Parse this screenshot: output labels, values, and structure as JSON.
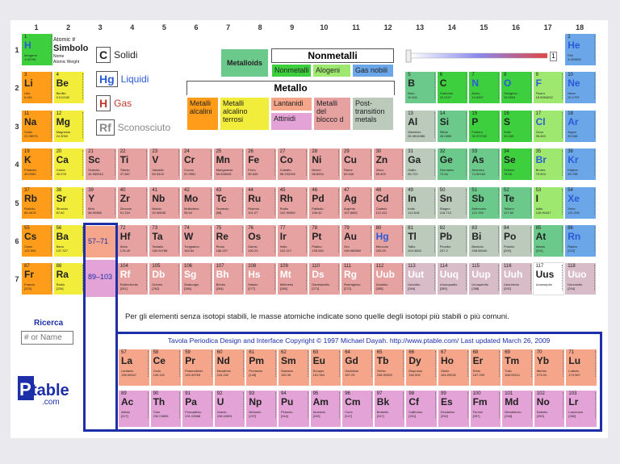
{
  "groups": [
    "1",
    "2",
    "3",
    "4",
    "5",
    "6",
    "7",
    "8",
    "9",
    "10",
    "11",
    "12",
    "13",
    "14",
    "15",
    "16",
    "17",
    "18"
  ],
  "periods": [
    "1",
    "2",
    "3",
    "4",
    "5",
    "6",
    "7"
  ],
  "legend": {
    "atomic_no_label": "Atomic #",
    "symbol_label": "Simbolo",
    "name_label": "Nome",
    "mass_label": "Atomic Weight",
    "states": [
      {
        "code": "C",
        "label": "Solidi",
        "color": "#222222"
      },
      {
        "code": "Hg",
        "label": "Liquidi",
        "color": "#2a5bd7"
      },
      {
        "code": "H",
        "label": "Gas",
        "color": "#c0392b"
      },
      {
        "code": "Rf",
        "label": "Sconosciuto",
        "color": "#888888"
      }
    ],
    "metalloids": "Metalloids",
    "nonmetals_header": "Nonmetalli",
    "nonmetals": [
      {
        "label": "Nonmetalli",
        "color": "#3ecf3e"
      },
      {
        "label": "Alogeni",
        "color": "#9fe86f"
      },
      {
        "label": "Gas nobili",
        "color": "#6aa6e8"
      }
    ],
    "metals_header": "Metallo",
    "metals": [
      {
        "label": "Metalli alcalini",
        "color": "#ff9d1a"
      },
      {
        "label": "Metalli alcalino terrosi",
        "color": "#f2ec3a"
      },
      {
        "label": "Lantanidi",
        "color": "#f4a58a"
      },
      {
        "label": "Attinidi",
        "color": "#e4a3d6"
      },
      {
        "label": "Metalli del blocco d",
        "color": "#e6a1a1"
      },
      {
        "label": "Post-transition metals",
        "color": "#bccabc"
      }
    ],
    "slider_value": "1"
  },
  "colors": {
    "alkali": "#ff9d1a",
    "alkaline": "#f2ec3a",
    "transition": "#e6a1a1",
    "post": "#bccabc",
    "metalloid": "#6cc98c",
    "nonmetal": "#3ecf3e",
    "halogen": "#9fe86f",
    "noble": "#6aa6e8",
    "lanthanide": "#f4a58a",
    "actinide": "#e4a3d6",
    "unknown": "#d8bcc8",
    "hydrogen": "#3ecf3e"
  },
  "elements": [
    {
      "n": "1",
      "s": "H",
      "nm": "Idrogeno",
      "m": "1.00794",
      "g": 1,
      "p": 1,
      "c": "hydrogen",
      "st": "gas"
    },
    {
      "n": "2",
      "s": "He",
      "nm": "Elio",
      "m": "4.002602",
      "g": 18,
      "p": 1,
      "c": "noble",
      "st": "gas"
    },
    {
      "n": "3",
      "s": "Li",
      "nm": "Litio",
      "m": "6.941",
      "g": 1,
      "p": 2,
      "c": "alkali"
    },
    {
      "n": "4",
      "s": "Be",
      "nm": "Berillio",
      "m": "9.012182",
      "g": 2,
      "p": 2,
      "c": "alkaline"
    },
    {
      "n": "5",
      "s": "B",
      "nm": "Boro",
      "m": "10.811",
      "g": 13,
      "p": 2,
      "c": "metalloid"
    },
    {
      "n": "6",
      "s": "C",
      "nm": "Carbonio",
      "m": "12.0107",
      "g": 14,
      "p": 2,
      "c": "nonmetal"
    },
    {
      "n": "7",
      "s": "N",
      "nm": "Azoto",
      "m": "14.0067",
      "g": 15,
      "p": 2,
      "c": "nonmetal",
      "st": "gas"
    },
    {
      "n": "8",
      "s": "O",
      "nm": "Ossigeno",
      "m": "15.9994",
      "g": 16,
      "p": 2,
      "c": "nonmetal",
      "st": "gas"
    },
    {
      "n": "9",
      "s": "F",
      "nm": "Fluoro",
      "m": "18.9984032",
      "g": 17,
      "p": 2,
      "c": "halogen",
      "st": "gas"
    },
    {
      "n": "10",
      "s": "Ne",
      "nm": "Neon",
      "m": "20.1797",
      "g": 18,
      "p": 2,
      "c": "noble",
      "st": "gas"
    },
    {
      "n": "11",
      "s": "Na",
      "nm": "Sodio",
      "m": "22.98976",
      "g": 1,
      "p": 3,
      "c": "alkali"
    },
    {
      "n": "12",
      "s": "Mg",
      "nm": "Magnesio",
      "m": "24.3050",
      "g": 2,
      "p": 3,
      "c": "alkaline"
    },
    {
      "n": "13",
      "s": "Al",
      "nm": "Alluminio",
      "m": "26.9815386",
      "g": 13,
      "p": 3,
      "c": "post"
    },
    {
      "n": "14",
      "s": "Si",
      "nm": "Silicio",
      "m": "28.0855",
      "g": 14,
      "p": 3,
      "c": "metalloid"
    },
    {
      "n": "15",
      "s": "P",
      "nm": "Fosforo",
      "m": "30.973762",
      "g": 15,
      "p": 3,
      "c": "nonmetal"
    },
    {
      "n": "16",
      "s": "S",
      "nm": "Zolfo",
      "m": "32.065",
      "g": 16,
      "p": 3,
      "c": "nonmetal"
    },
    {
      "n": "17",
      "s": "Cl",
      "nm": "Cloro",
      "m": "35.453",
      "g": 17,
      "p": 3,
      "c": "halogen",
      "st": "gas"
    },
    {
      "n": "18",
      "s": "Ar",
      "nm": "Argon",
      "m": "39.948",
      "g": 18,
      "p": 3,
      "c": "noble",
      "st": "gas"
    },
    {
      "n": "19",
      "s": "K",
      "nm": "Potassio",
      "m": "39.0983",
      "g": 1,
      "p": 4,
      "c": "alkali"
    },
    {
      "n": "20",
      "s": "Ca",
      "nm": "Calcio",
      "m": "40.078",
      "g": 2,
      "p": 4,
      "c": "alkaline"
    },
    {
      "n": "21",
      "s": "Sc",
      "nm": "Scandio",
      "m": "44.955912",
      "g": 3,
      "p": 4,
      "c": "transition"
    },
    {
      "n": "22",
      "s": "Ti",
      "nm": "Titanio",
      "m": "47.867",
      "g": 4,
      "p": 4,
      "c": "transition"
    },
    {
      "n": "23",
      "s": "V",
      "nm": "Vanadio",
      "m": "50.9415",
      "g": 5,
      "p": 4,
      "c": "transition"
    },
    {
      "n": "24",
      "s": "Cr",
      "nm": "Cromo",
      "m": "51.9961",
      "g": 6,
      "p": 4,
      "c": "transition"
    },
    {
      "n": "25",
      "s": "Mn",
      "nm": "Manganese",
      "m": "54.938045",
      "g": 7,
      "p": 4,
      "c": "transition"
    },
    {
      "n": "26",
      "s": "Fe",
      "nm": "Ferro",
      "m": "55.845",
      "g": 8,
      "p": 4,
      "c": "transition"
    },
    {
      "n": "27",
      "s": "Co",
      "nm": "Cobalto",
      "m": "58.933195",
      "g": 9,
      "p": 4,
      "c": "transition"
    },
    {
      "n": "28",
      "s": "Ni",
      "nm": "Nichel",
      "m": "58.6934",
      "g": 10,
      "p": 4,
      "c": "transition"
    },
    {
      "n": "29",
      "s": "Cu",
      "nm": "Rame",
      "m": "63.546",
      "g": 11,
      "p": 4,
      "c": "transition"
    },
    {
      "n": "30",
      "s": "Zn",
      "nm": "Zinco",
      "m": "65.409",
      "g": 12,
      "p": 4,
      "c": "transition"
    },
    {
      "n": "31",
      "s": "Ga",
      "nm": "Gallio",
      "m": "69.723",
      "g": 13,
      "p": 4,
      "c": "post"
    },
    {
      "n": "32",
      "s": "Ge",
      "nm": "Germanio",
      "m": "72.64",
      "g": 14,
      "p": 4,
      "c": "metalloid"
    },
    {
      "n": "33",
      "s": "As",
      "nm": "Arsenico",
      "m": "74.92160",
      "g": 15,
      "p": 4,
      "c": "metalloid"
    },
    {
      "n": "34",
      "s": "Se",
      "nm": "Selenio",
      "m": "78.96",
      "g": 16,
      "p": 4,
      "c": "nonmetal"
    },
    {
      "n": "35",
      "s": "Br",
      "nm": "Bromo",
      "m": "79.904",
      "g": 17,
      "p": 4,
      "c": "halogen",
      "st": "liq"
    },
    {
      "n": "36",
      "s": "Kr",
      "nm": "Kripton",
      "m": "83.798",
      "g": 18,
      "p": 4,
      "c": "noble",
      "st": "gas"
    },
    {
      "n": "37",
      "s": "Rb",
      "nm": "Rubidio",
      "m": "85.4678",
      "g": 1,
      "p": 5,
      "c": "alkali"
    },
    {
      "n": "38",
      "s": "Sr",
      "nm": "Stronzio",
      "m": "87.62",
      "g": 2,
      "p": 5,
      "c": "alkaline"
    },
    {
      "n": "39",
      "s": "Y",
      "nm": "Ittrio",
      "m": "88.90585",
      "g": 3,
      "p": 5,
      "c": "transition"
    },
    {
      "n": "40",
      "s": "Zr",
      "nm": "Zirconio",
      "m": "91.224",
      "g": 4,
      "p": 5,
      "c": "transition"
    },
    {
      "n": "41",
      "s": "Nb",
      "nm": "Niobio",
      "m": "92.90638",
      "g": 5,
      "p": 5,
      "c": "transition"
    },
    {
      "n": "42",
      "s": "Mo",
      "nm": "Molibdeno",
      "m": "95.94",
      "g": 6,
      "p": 5,
      "c": "transition"
    },
    {
      "n": "43",
      "s": "Tc",
      "nm": "Tecnezio",
      "m": "[98]",
      "g": 7,
      "p": 5,
      "c": "transition"
    },
    {
      "n": "44",
      "s": "Ru",
      "nm": "Rutenio",
      "m": "101.07",
      "g": 8,
      "p": 5,
      "c": "transition"
    },
    {
      "n": "45",
      "s": "Rh",
      "nm": "Rodio",
      "m": "102.90550",
      "g": 9,
      "p": 5,
      "c": "transition"
    },
    {
      "n": "46",
      "s": "Pd",
      "nm": "Palladio",
      "m": "106.42",
      "g": 10,
      "p": 5,
      "c": "transition"
    },
    {
      "n": "47",
      "s": "Ag",
      "nm": "Argento",
      "m": "107.8682",
      "g": 11,
      "p": 5,
      "c": "transition"
    },
    {
      "n": "48",
      "s": "Cd",
      "nm": "Cadmio",
      "m": "112.411",
      "g": 12,
      "p": 5,
      "c": "transition"
    },
    {
      "n": "49",
      "s": "In",
      "nm": "Indio",
      "m": "114.818",
      "g": 13,
      "p": 5,
      "c": "post"
    },
    {
      "n": "50",
      "s": "Sn",
      "nm": "Stagno",
      "m": "118.710",
      "g": 14,
      "p": 5,
      "c": "post"
    },
    {
      "n": "51",
      "s": "Sb",
      "nm": "Antimonio",
      "m": "121.760",
      "g": 15,
      "p": 5,
      "c": "metalloid"
    },
    {
      "n": "52",
      "s": "Te",
      "nm": "Tellurio",
      "m": "127.60",
      "g": 16,
      "p": 5,
      "c": "metalloid"
    },
    {
      "n": "53",
      "s": "I",
      "nm": "Iodio",
      "m": "126.90447",
      "g": 17,
      "p": 5,
      "c": "halogen"
    },
    {
      "n": "54",
      "s": "Xe",
      "nm": "Xeno",
      "m": "131.293",
      "g": 18,
      "p": 5,
      "c": "noble",
      "st": "gas"
    },
    {
      "n": "55",
      "s": "Cs",
      "nm": "Cesio",
      "m": "132.905",
      "g": 1,
      "p": 6,
      "c": "alkali"
    },
    {
      "n": "56",
      "s": "Ba",
      "nm": "Bario",
      "m": "137.327",
      "g": 2,
      "p": 6,
      "c": "alkaline"
    },
    {
      "n": "72",
      "s": "Hf",
      "nm": "Afnio",
      "m": "178.49",
      "g": 4,
      "p": 6,
      "c": "transition"
    },
    {
      "n": "73",
      "s": "Ta",
      "nm": "Tantalio",
      "m": "180.94788",
      "g": 5,
      "p": 6,
      "c": "transition"
    },
    {
      "n": "74",
      "s": "W",
      "nm": "Tungsteno",
      "m": "183.84",
      "g": 6,
      "p": 6,
      "c": "transition"
    },
    {
      "n": "75",
      "s": "Re",
      "nm": "Renio",
      "m": "186.207",
      "g": 7,
      "p": 6,
      "c": "transition"
    },
    {
      "n": "76",
      "s": "Os",
      "nm": "Osmio",
      "m": "190.23",
      "g": 8,
      "p": 6,
      "c": "transition"
    },
    {
      "n": "77",
      "s": "Ir",
      "nm": "Iridio",
      "m": "192.217",
      "g": 9,
      "p": 6,
      "c": "transition"
    },
    {
      "n": "78",
      "s": "Pt",
      "nm": "Platino",
      "m": "195.084",
      "g": 10,
      "p": 6,
      "c": "transition"
    },
    {
      "n": "79",
      "s": "Au",
      "nm": "Oro",
      "m": "196.966569",
      "g": 11,
      "p": 6,
      "c": "transition"
    },
    {
      "n": "80",
      "s": "Hg",
      "nm": "Mercurio",
      "m": "200.59",
      "g": 12,
      "p": 6,
      "c": "transition",
      "st": "liq"
    },
    {
      "n": "81",
      "s": "Tl",
      "nm": "Tallio",
      "m": "204.3833",
      "g": 13,
      "p": 6,
      "c": "post"
    },
    {
      "n": "82",
      "s": "Pb",
      "nm": "Piombo",
      "m": "207.2",
      "g": 14,
      "p": 6,
      "c": "post"
    },
    {
      "n": "83",
      "s": "Bi",
      "nm": "Bismuto",
      "m": "208.98040",
      "g": 15,
      "p": 6,
      "c": "post"
    },
    {
      "n": "84",
      "s": "Po",
      "nm": "Polonio",
      "m": "[209]",
      "g": 16,
      "p": 6,
      "c": "post"
    },
    {
      "n": "85",
      "s": "At",
      "nm": "Astato",
      "m": "[210]",
      "g": 17,
      "p": 6,
      "c": "metalloid"
    },
    {
      "n": "86",
      "s": "Rn",
      "nm": "Radon",
      "m": "[222]",
      "g": 18,
      "p": 6,
      "c": "noble",
      "st": "gas"
    },
    {
      "n": "87",
      "s": "Fr",
      "nm": "Francio",
      "m": "[223]",
      "g": 1,
      "p": 7,
      "c": "alkali"
    },
    {
      "n": "88",
      "s": "Ra",
      "nm": "Radio",
      "m": "[226]",
      "g": 2,
      "p": 7,
      "c": "alkaline"
    },
    {
      "n": "104",
      "s": "Rf",
      "nm": "Rutherfordio",
      "m": "[261]",
      "g": 4,
      "p": 7,
      "c": "transition",
      "st": "unk"
    },
    {
      "n": "105",
      "s": "Db",
      "nm": "Dubnio",
      "m": "[262]",
      "g": 5,
      "p": 7,
      "c": "transition",
      "st": "unk"
    },
    {
      "n": "106",
      "s": "Sg",
      "nm": "Seaborgio",
      "m": "[266]",
      "g": 6,
      "p": 7,
      "c": "transition",
      "st": "unk"
    },
    {
      "n": "107",
      "s": "Bh",
      "nm": "Bohrio",
      "m": "[264]",
      "g": 7,
      "p": 7,
      "c": "transition",
      "st": "unk"
    },
    {
      "n": "108",
      "s": "Hs",
      "nm": "Hassio",
      "m": "[277]",
      "g": 8,
      "p": 7,
      "c": "transition",
      "st": "unk"
    },
    {
      "n": "109",
      "s": "Mt",
      "nm": "Meitnerio",
      "m": "[268]",
      "g": 9,
      "p": 7,
      "c": "transition",
      "st": "unk"
    },
    {
      "n": "110",
      "s": "Ds",
      "nm": "Darmstadtio",
      "m": "[271]",
      "g": 10,
      "p": 7,
      "c": "transition",
      "st": "unk"
    },
    {
      "n": "111",
      "s": "Rg",
      "nm": "Roentgenio",
      "m": "[272]",
      "g": 11,
      "p": 7,
      "c": "transition",
      "st": "unk"
    },
    {
      "n": "112",
      "s": "Uub",
      "nm": "Ununbio",
      "m": "[285]",
      "g": 12,
      "p": 7,
      "c": "transition",
      "st": "unk"
    },
    {
      "n": "113",
      "s": "Uut",
      "nm": "Ununtrio",
      "m": "[284]",
      "g": 13,
      "p": 7,
      "c": "unknown",
      "st": "unk"
    },
    {
      "n": "114",
      "s": "Uuq",
      "nm": "Ununquadio",
      "m": "[289]",
      "g": 14,
      "p": 7,
      "c": "unknown",
      "st": "unk"
    },
    {
      "n": "115",
      "s": "Uup",
      "nm": "Ununpentio",
      "m": "[288]",
      "g": 15,
      "p": 7,
      "c": "unknown",
      "st": "unk"
    },
    {
      "n": "116",
      "s": "Uuh",
      "nm": "Ununhexio",
      "m": "[292]",
      "g": 16,
      "p": 7,
      "c": "unknown",
      "st": "unk"
    },
    {
      "n": "117",
      "s": "Uus",
      "nm": "Ununseptio",
      "m": "",
      "g": 17,
      "p": 7,
      "c": "empty"
    },
    {
      "n": "118",
      "s": "Uuo",
      "nm": "Ununoctio",
      "m": "[294]",
      "g": 18,
      "p": 7,
      "c": "unknown",
      "st": "unk"
    }
  ],
  "lanthanides": [
    {
      "n": "57",
      "s": "La",
      "nm": "Lantanio",
      "m": "138.90547"
    },
    {
      "n": "58",
      "s": "Ce",
      "nm": "Cerio",
      "m": "140.116"
    },
    {
      "n": "59",
      "s": "Pr",
      "nm": "Praseodimio",
      "m": "140.90765"
    },
    {
      "n": "60",
      "s": "Nd",
      "nm": "Neodimio",
      "m": "144.242"
    },
    {
      "n": "61",
      "s": "Pm",
      "nm": "Promezio",
      "m": "[145]"
    },
    {
      "n": "62",
      "s": "Sm",
      "nm": "Samario",
      "m": "150.36"
    },
    {
      "n": "63",
      "s": "Eu",
      "nm": "Europio",
      "m": "151.964"
    },
    {
      "n": "64",
      "s": "Gd",
      "nm": "Gadolinio",
      "m": "157.25"
    },
    {
      "n": "65",
      "s": "Tb",
      "nm": "Terbio",
      "m": "158.92535"
    },
    {
      "n": "66",
      "s": "Dy",
      "nm": "Disprosio",
      "m": "162.500"
    },
    {
      "n": "67",
      "s": "Ho",
      "nm": "Olmio",
      "m": "164.93032"
    },
    {
      "n": "68",
      "s": "Er",
      "nm": "Erbio",
      "m": "167.259"
    },
    {
      "n": "69",
      "s": "Tm",
      "nm": "Tulio",
      "m": "168.93421"
    },
    {
      "n": "70",
      "s": "Yb",
      "nm": "Itterbio",
      "m": "173.04"
    },
    {
      "n": "71",
      "s": "Lu",
      "nm": "Lutezio",
      "m": "174.967"
    }
  ],
  "actinides": [
    {
      "n": "89",
      "s": "Ac",
      "nm": "Attinio",
      "m": "[227]"
    },
    {
      "n": "90",
      "s": "Th",
      "nm": "Torio",
      "m": "232.03806"
    },
    {
      "n": "91",
      "s": "Pa",
      "nm": "Protoattinio",
      "m": "231.03588"
    },
    {
      "n": "92",
      "s": "U",
      "nm": "Uranio",
      "m": "238.02891"
    },
    {
      "n": "93",
      "s": "Np",
      "nm": "Nettunio",
      "m": "[237]"
    },
    {
      "n": "94",
      "s": "Pu",
      "nm": "Plutonio",
      "m": "[244]"
    },
    {
      "n": "95",
      "s": "Am",
      "nm": "Americio",
      "m": "[243]"
    },
    {
      "n": "96",
      "s": "Cm",
      "nm": "Curio",
      "m": "[247]"
    },
    {
      "n": "97",
      "s": "Bk",
      "nm": "Berkelio",
      "m": "[247]"
    },
    {
      "n": "98",
      "s": "Cf",
      "nm": "Californio",
      "m": "[251]"
    },
    {
      "n": "99",
      "s": "Es",
      "nm": "Einsteinio",
      "m": "[252]"
    },
    {
      "n": "100",
      "s": "Fm",
      "nm": "Fermio",
      "m": "[257]"
    },
    {
      "n": "101",
      "s": "Md",
      "nm": "Mendelevio",
      "m": "[258]"
    },
    {
      "n": "102",
      "s": "No",
      "nm": "Nobelio",
      "m": "[259]"
    },
    {
      "n": "103",
      "s": "Lr",
      "nm": "Laurenzio",
      "m": "[262]"
    }
  ],
  "placeholders": {
    "lanthanide_range": "57–71",
    "actinide_range": "89–103"
  },
  "note": "Per gli elementi senza isotopi stabili, le masse atomiche indicate sono quelle degli isotopi più stabili o più comuni.",
  "copyright": "Tavola Periodica Design and Interface Copyright © 1997 Michael Dayah. http://www.ptable.com/ Last updated March 26, 2009",
  "search": {
    "label": "Ricerca",
    "placeholder": "# or Name"
  },
  "logo": {
    "text": "Ptable",
    ".com": ".com"
  }
}
